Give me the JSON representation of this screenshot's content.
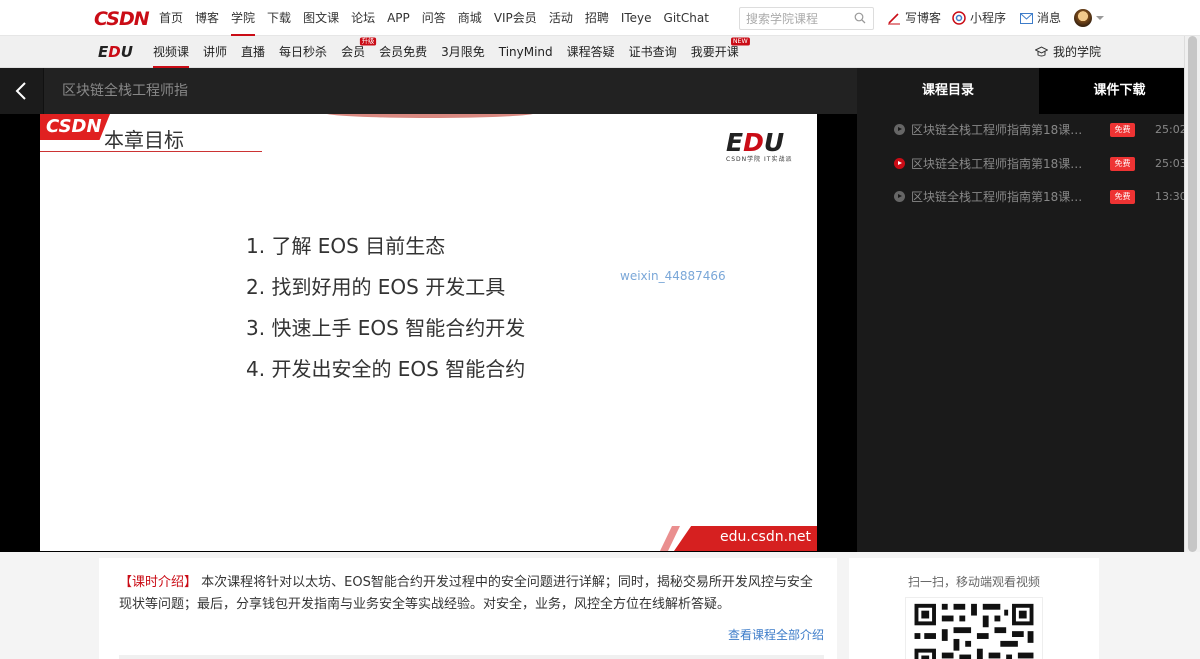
{
  "header": {
    "logo": "CSDN",
    "nav": [
      "首页",
      "博客",
      "学院",
      "下载",
      "图文课",
      "论坛",
      "APP",
      "问答",
      "商城",
      "VIP会员",
      "活动",
      "招聘",
      "ITeye",
      "GitChat"
    ],
    "active_nav": "学院",
    "search_placeholder": "搜索学院课程",
    "write_blog": "写博客",
    "mini_program": "小程序",
    "messages": "消息"
  },
  "subnav": {
    "logo_e": "E",
    "logo_d": "D",
    "logo_u": "U",
    "items": [
      "视频课",
      "讲师",
      "直播",
      "每日秒杀",
      "会员",
      "会员免费",
      "3月限免",
      "TinyMind",
      "课程答疑",
      "证书查询",
      "我要开课"
    ],
    "active": "视频课",
    "member_tag": "升级",
    "new_tag": "NEW",
    "my_school": "我的学院"
  },
  "player": {
    "title": "区块链全栈工程师指",
    "tabs": [
      "课程目录",
      "课件下载"
    ],
    "lessons": [
      {
        "title": "区块链全栈工程师指南第18课—...",
        "badge": "免费",
        "duration": "25:02",
        "current": false
      },
      {
        "title": "区块链全栈工程师指南第18课—...",
        "badge": "免费",
        "duration": "25:03",
        "current": true
      },
      {
        "title": "区块链全栈工程师指南第18课—...",
        "badge": "免费",
        "duration": "13:30",
        "current": false
      }
    ]
  },
  "slide": {
    "corner_logo": "CSDN",
    "heading": "本章目标",
    "edu_e": "E",
    "edu_d": "D",
    "edu_u": "U",
    "edu_sub": "CSDN学院    IT实战派",
    "items": [
      "1.  了解 EOS 目前生态",
      "2.  找到好用的 EOS 开发工具",
      "3.  快速上手 EOS 智能合约开发",
      "4.  开发出安全的 EOS 智能合约"
    ],
    "watermark": "weixin_44887466",
    "footer": "edu.csdn.net"
  },
  "intro": {
    "label": "【课时介绍】",
    "text": " 本次课程将针对以太坊、EOS智能合约开发过程中的安全问题进行详解；同时，揭秘交易所开发风控与安全现状等问题；最后，分享钱包开发指南与业务安全等实战经验。对安全，业务，风控全方位在线解析答疑。",
    "more": "查看课程全部介绍"
  },
  "qr": {
    "title": "扫一扫，移动端观看视频"
  },
  "colors": {
    "brand_red": "#ca0c16",
    "link_blue": "#3d7cc9"
  }
}
